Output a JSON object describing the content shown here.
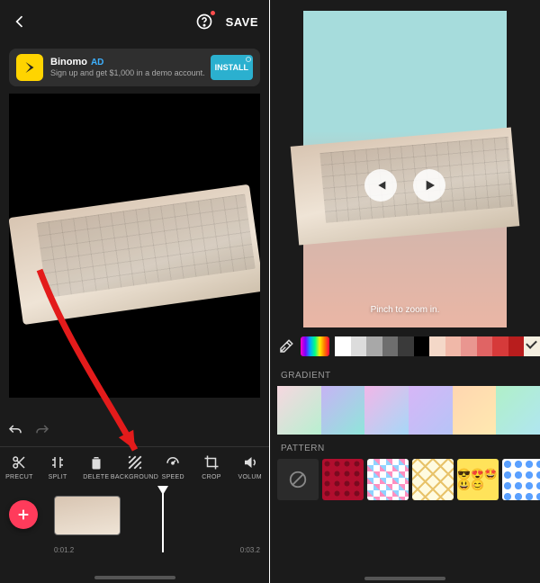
{
  "left": {
    "save_label": "SAVE",
    "ad": {
      "title": "Binomo",
      "tag": "AD",
      "desc": "Sign up and get $1,000 in a demo account.",
      "cta": "INSTALL"
    },
    "tools": {
      "precut": "PRECUT",
      "split": "SPLIT",
      "delete": "DELETE",
      "background": "BACKGROUND",
      "speed": "SPEED",
      "crop": "CROP",
      "volume": "VOLUM"
    },
    "time": {
      "current": "0:01.2",
      "total": "0:03.2"
    }
  },
  "right": {
    "hint": "Pinch to zoom in.",
    "sections": {
      "gradient": "GRADIENT",
      "pattern": "PATTERN"
    },
    "swatches": [
      "#ffffff",
      "#dcdcdc",
      "#a8a8a8",
      "#6e6e6e",
      "#3a3a3a",
      "#000000",
      "#f4d8c8",
      "#f0b8a8",
      "#e99690",
      "#e06464",
      "#d63a3a",
      "#b81d1d",
      "#f4efe0"
    ],
    "selected_swatch_index": 12,
    "gradients": [
      [
        "#f7d7e0",
        "#b7f0d0"
      ],
      [
        "#c7b3f5",
        "#8fe6da"
      ],
      [
        "#f2b6e8",
        "#a6d8f7"
      ],
      [
        "#d7b6f7",
        "#b6c4f7"
      ],
      [
        "#ffd6b0",
        "#ffe9b0"
      ],
      [
        "#b0f0c8",
        "#b0e6f0"
      ]
    ],
    "pattern_none": "∅"
  }
}
